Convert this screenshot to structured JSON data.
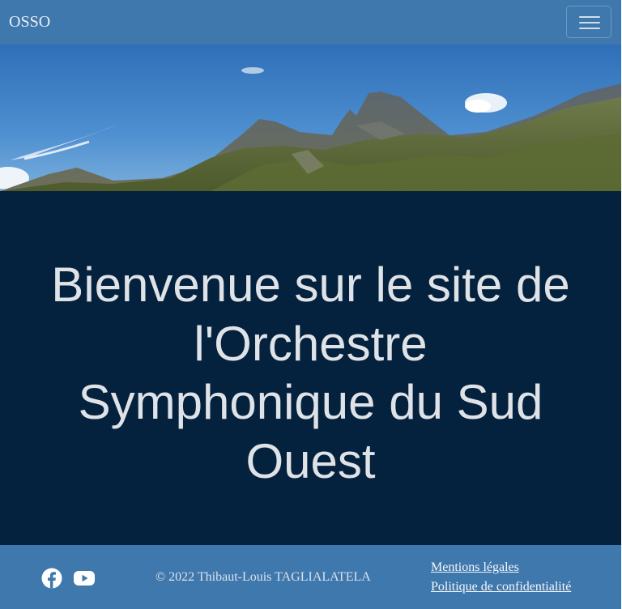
{
  "navbar": {
    "brand": "OSSO",
    "toggle_icon": "hamburger-menu-icon"
  },
  "banner": {
    "image_subject": "mountain-landscape"
  },
  "hero": {
    "title": "Bienvenue sur le site de l'Orchestre Symphonique du Sud Ouest"
  },
  "footer": {
    "social_icons": [
      "facebook-icon",
      "youtube-icon"
    ],
    "copyright": "© 2022 Thibaut-Louis TAGLIALATELA",
    "links": [
      "Mentions légales",
      "Politique de confidentialité"
    ]
  },
  "colors": {
    "navbar_bg": "#3f78ad",
    "hero_bg": "#04223e",
    "hero_text": "#dfe3e7",
    "footer_bg": "#3f78ad"
  }
}
